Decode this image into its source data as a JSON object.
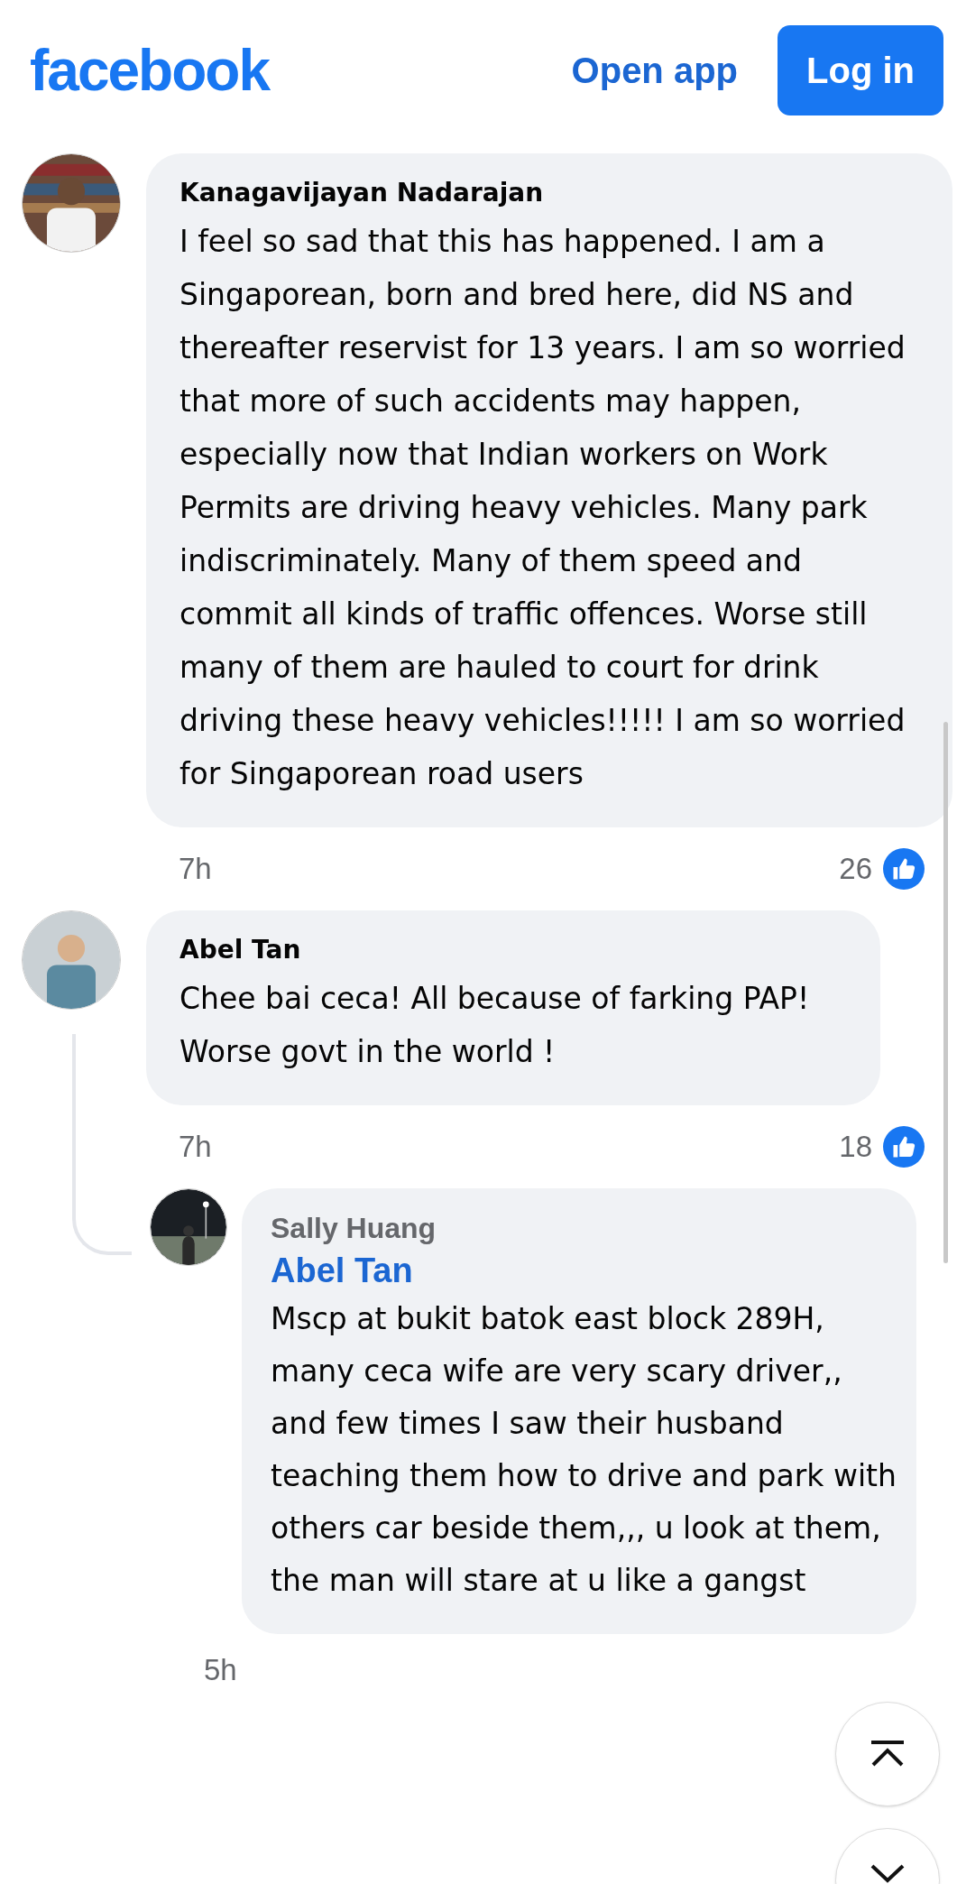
{
  "header": {
    "logo": "facebook",
    "open_app": "Open app",
    "login": "Log in"
  },
  "comments": [
    {
      "author": "Kanagavijayan Nadarajan",
      "body": "I feel so sad that this has happened. I am a Singaporean, born and bred here, did NS and thereafter reservist for 13 years. I am so worried that more of such accidents may happen, especially now that Indian workers on Work Permits are driving heavy vehicles. Many park indiscriminately. Many of them speed and commit all kinds of traffic offences. Worse still many of them are hauled to court for drink driving these heavy vehicles!!!!! I am so worried for Singaporean road users",
      "time": "7h",
      "likes": "26"
    },
    {
      "author": "Abel Tan",
      "body": "Chee bai ceca! All because of farking PAP! Worse govt in the world !",
      "time": "7h",
      "likes": "18",
      "replies": [
        {
          "author": "Sally Huang",
          "mention": "Abel Tan",
          "body": "Mscp at bukit batok east block 289H, many ceca wife are very scary driver,, and few times I saw their husband teaching them how to drive and park with others car beside them,,, u look at them, the man will stare at u like a gangst",
          "time": "5h"
        }
      ]
    }
  ]
}
